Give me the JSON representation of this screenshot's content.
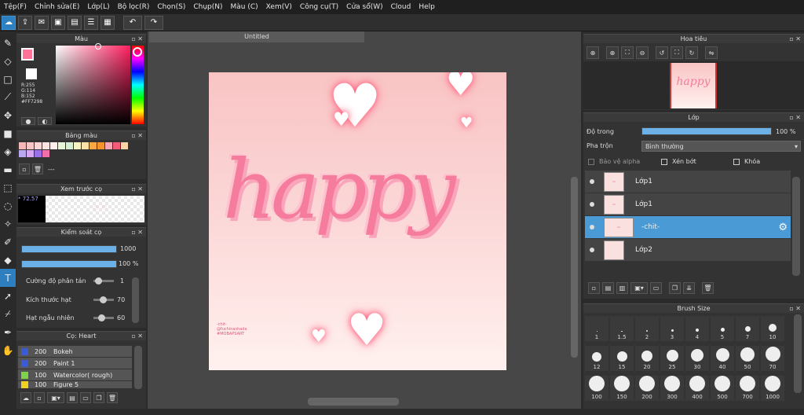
{
  "menu": [
    "Tệp(F)",
    "Chỉnh sửa(E)",
    "Lớp(L)",
    "Bộ lọc(R)",
    "Chọn(S)",
    "Chụp(N)",
    "Màu (C)",
    "Xem(V)",
    "Công cụ(T)",
    "Cửa sổ(W)",
    "Cloud",
    "Help"
  ],
  "color_panel": {
    "title": "Màu",
    "r": "R:255",
    "g": "G:114",
    "b": "B:152",
    "hex": "#FF7298",
    "fg": "#FF7298"
  },
  "palette": {
    "title": "Bảng màu",
    "colors": [
      "#f5b7b7",
      "#f7c7c7",
      "#f9d6d6",
      "#fbe3e3",
      "#fdeeee",
      "#e7f5d9",
      "#d6eed3",
      "#f7f0c0",
      "#fde2a8",
      "#f7a840",
      "#f3932b",
      "#f7a6b6",
      "#f45b78",
      "#fad3a8",
      "#b9a7ef",
      "#d6a6f0",
      "#9b71e8",
      "#f36fa9"
    ],
    "extra": "---"
  },
  "preview": {
    "title": "Xem trước cọ",
    "zoom": "72.57"
  },
  "brush_control": {
    "title": "Kiểm soát cọ",
    "size_value": "1000",
    "opacity_value": "100 %",
    "scatter_label": "Cường độ phân tán",
    "scatter_value": "1",
    "grain_label": "Kích thước hạt",
    "grain_value": "70",
    "random_label": "Hạt ngẫu nhiên",
    "random_value": "60"
  },
  "brush_list": {
    "title": "Cọ: Heart",
    "items": [
      {
        "size": "200",
        "name": "Bokeh",
        "color": "#3b5bd6"
      },
      {
        "size": "200",
        "name": "Paint 1",
        "color": "#3b5bd6"
      },
      {
        "size": "100",
        "name": "Watercolor( rough)",
        "color": "#7ed348"
      },
      {
        "size": "100",
        "name": "Figure 5",
        "color": "#f0d020"
      }
    ]
  },
  "document": {
    "tab": "Untitled",
    "text": "happy",
    "signature": [
      "-chit-",
      "@fuchinashada",
      "#MOBAPSART"
    ]
  },
  "navigator": {
    "title": "Hoa tiêu"
  },
  "layer_panel": {
    "title": "Lớp",
    "opacity_label": "Độ trong",
    "opacity_value": "100 %",
    "blend_label": "Pha trộn",
    "blend_value": "Bình thường",
    "protect_alpha": "Bảo vệ alpha",
    "clipping": "Xén bớt",
    "lock": "Khóa",
    "layers": [
      {
        "name": "Lớp1",
        "selected": false
      },
      {
        "name": "Lớp1",
        "selected": false
      },
      {
        "name": "-chit-",
        "selected": true
      },
      {
        "name": "Lớp2",
        "selected": false
      }
    ]
  },
  "brush_size": {
    "title": "Brush Size",
    "sizes": [
      "1",
      "1.5",
      "2",
      "3",
      "4",
      "5",
      "7",
      "10",
      "12",
      "15",
      "20",
      "25",
      "30",
      "40",
      "50",
      "70",
      "100",
      "150",
      "200",
      "300",
      "400",
      "500",
      "700",
      "1000"
    ]
  }
}
